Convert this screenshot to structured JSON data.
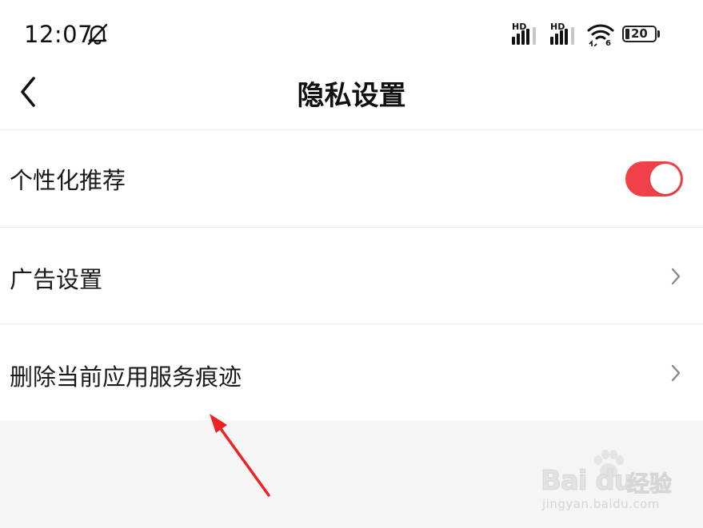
{
  "status_bar": {
    "time": "12:07",
    "sim1_label": "HD",
    "sim2_label": "HD",
    "wifi_badge": "6",
    "battery_level": "20"
  },
  "header": {
    "title": "隐私设置"
  },
  "settings": {
    "personalized_recommendation": {
      "label": "个性化推荐",
      "enabled": true
    },
    "ad_settings": {
      "label": "广告设置"
    },
    "clear_app_traces": {
      "label": "删除当前应用服务痕迹"
    }
  },
  "colors": {
    "toggle_on": "#f0414a",
    "annotation_arrow": "#ee2222"
  },
  "watermark": {
    "brand": "Bai du",
    "name": "经验",
    "url": "jingyan.baidu.com"
  }
}
